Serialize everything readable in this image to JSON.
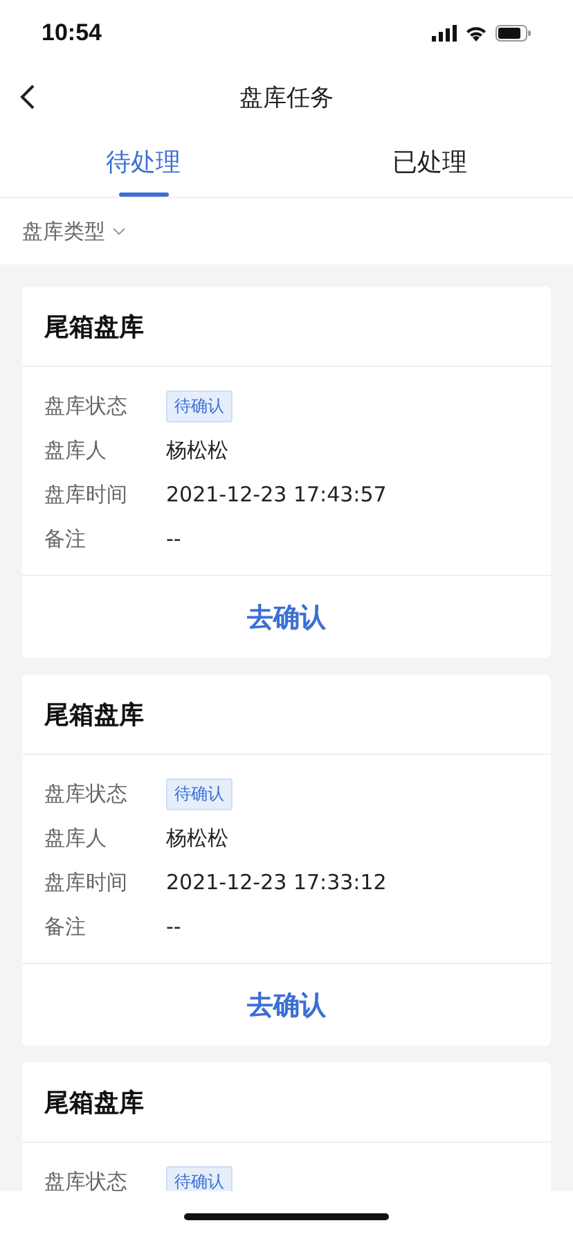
{
  "status_bar": {
    "time": "10:54"
  },
  "nav": {
    "title": "盘库任务"
  },
  "tabs": [
    {
      "label": "待处理",
      "selected": true
    },
    {
      "label": "已处理",
      "selected": false
    }
  ],
  "filter": {
    "label": "盘库类型"
  },
  "cards": [
    {
      "title": "尾箱盘库",
      "fields": [
        {
          "label": "盘库状态",
          "value": "待确认",
          "kind": "badge"
        },
        {
          "label": "盘库人",
          "value": "杨松松",
          "kind": "text"
        },
        {
          "label": "盘库时间",
          "value": "2021-12-23 17:43:57",
          "kind": "text"
        },
        {
          "label": "备注",
          "value": "--",
          "kind": "text"
        }
      ],
      "action": "去确认"
    },
    {
      "title": "尾箱盘库",
      "fields": [
        {
          "label": "盘库状态",
          "value": "待确认",
          "kind": "badge"
        },
        {
          "label": "盘库人",
          "value": "杨松松",
          "kind": "text"
        },
        {
          "label": "盘库时间",
          "value": "2021-12-23 17:33:12",
          "kind": "text"
        },
        {
          "label": "备注",
          "value": "--",
          "kind": "text"
        }
      ],
      "action": "去确认"
    },
    {
      "title": "尾箱盘库",
      "fields": [
        {
          "label": "盘库状态",
          "value": "待确认",
          "kind": "badge"
        }
      ]
    }
  ]
}
